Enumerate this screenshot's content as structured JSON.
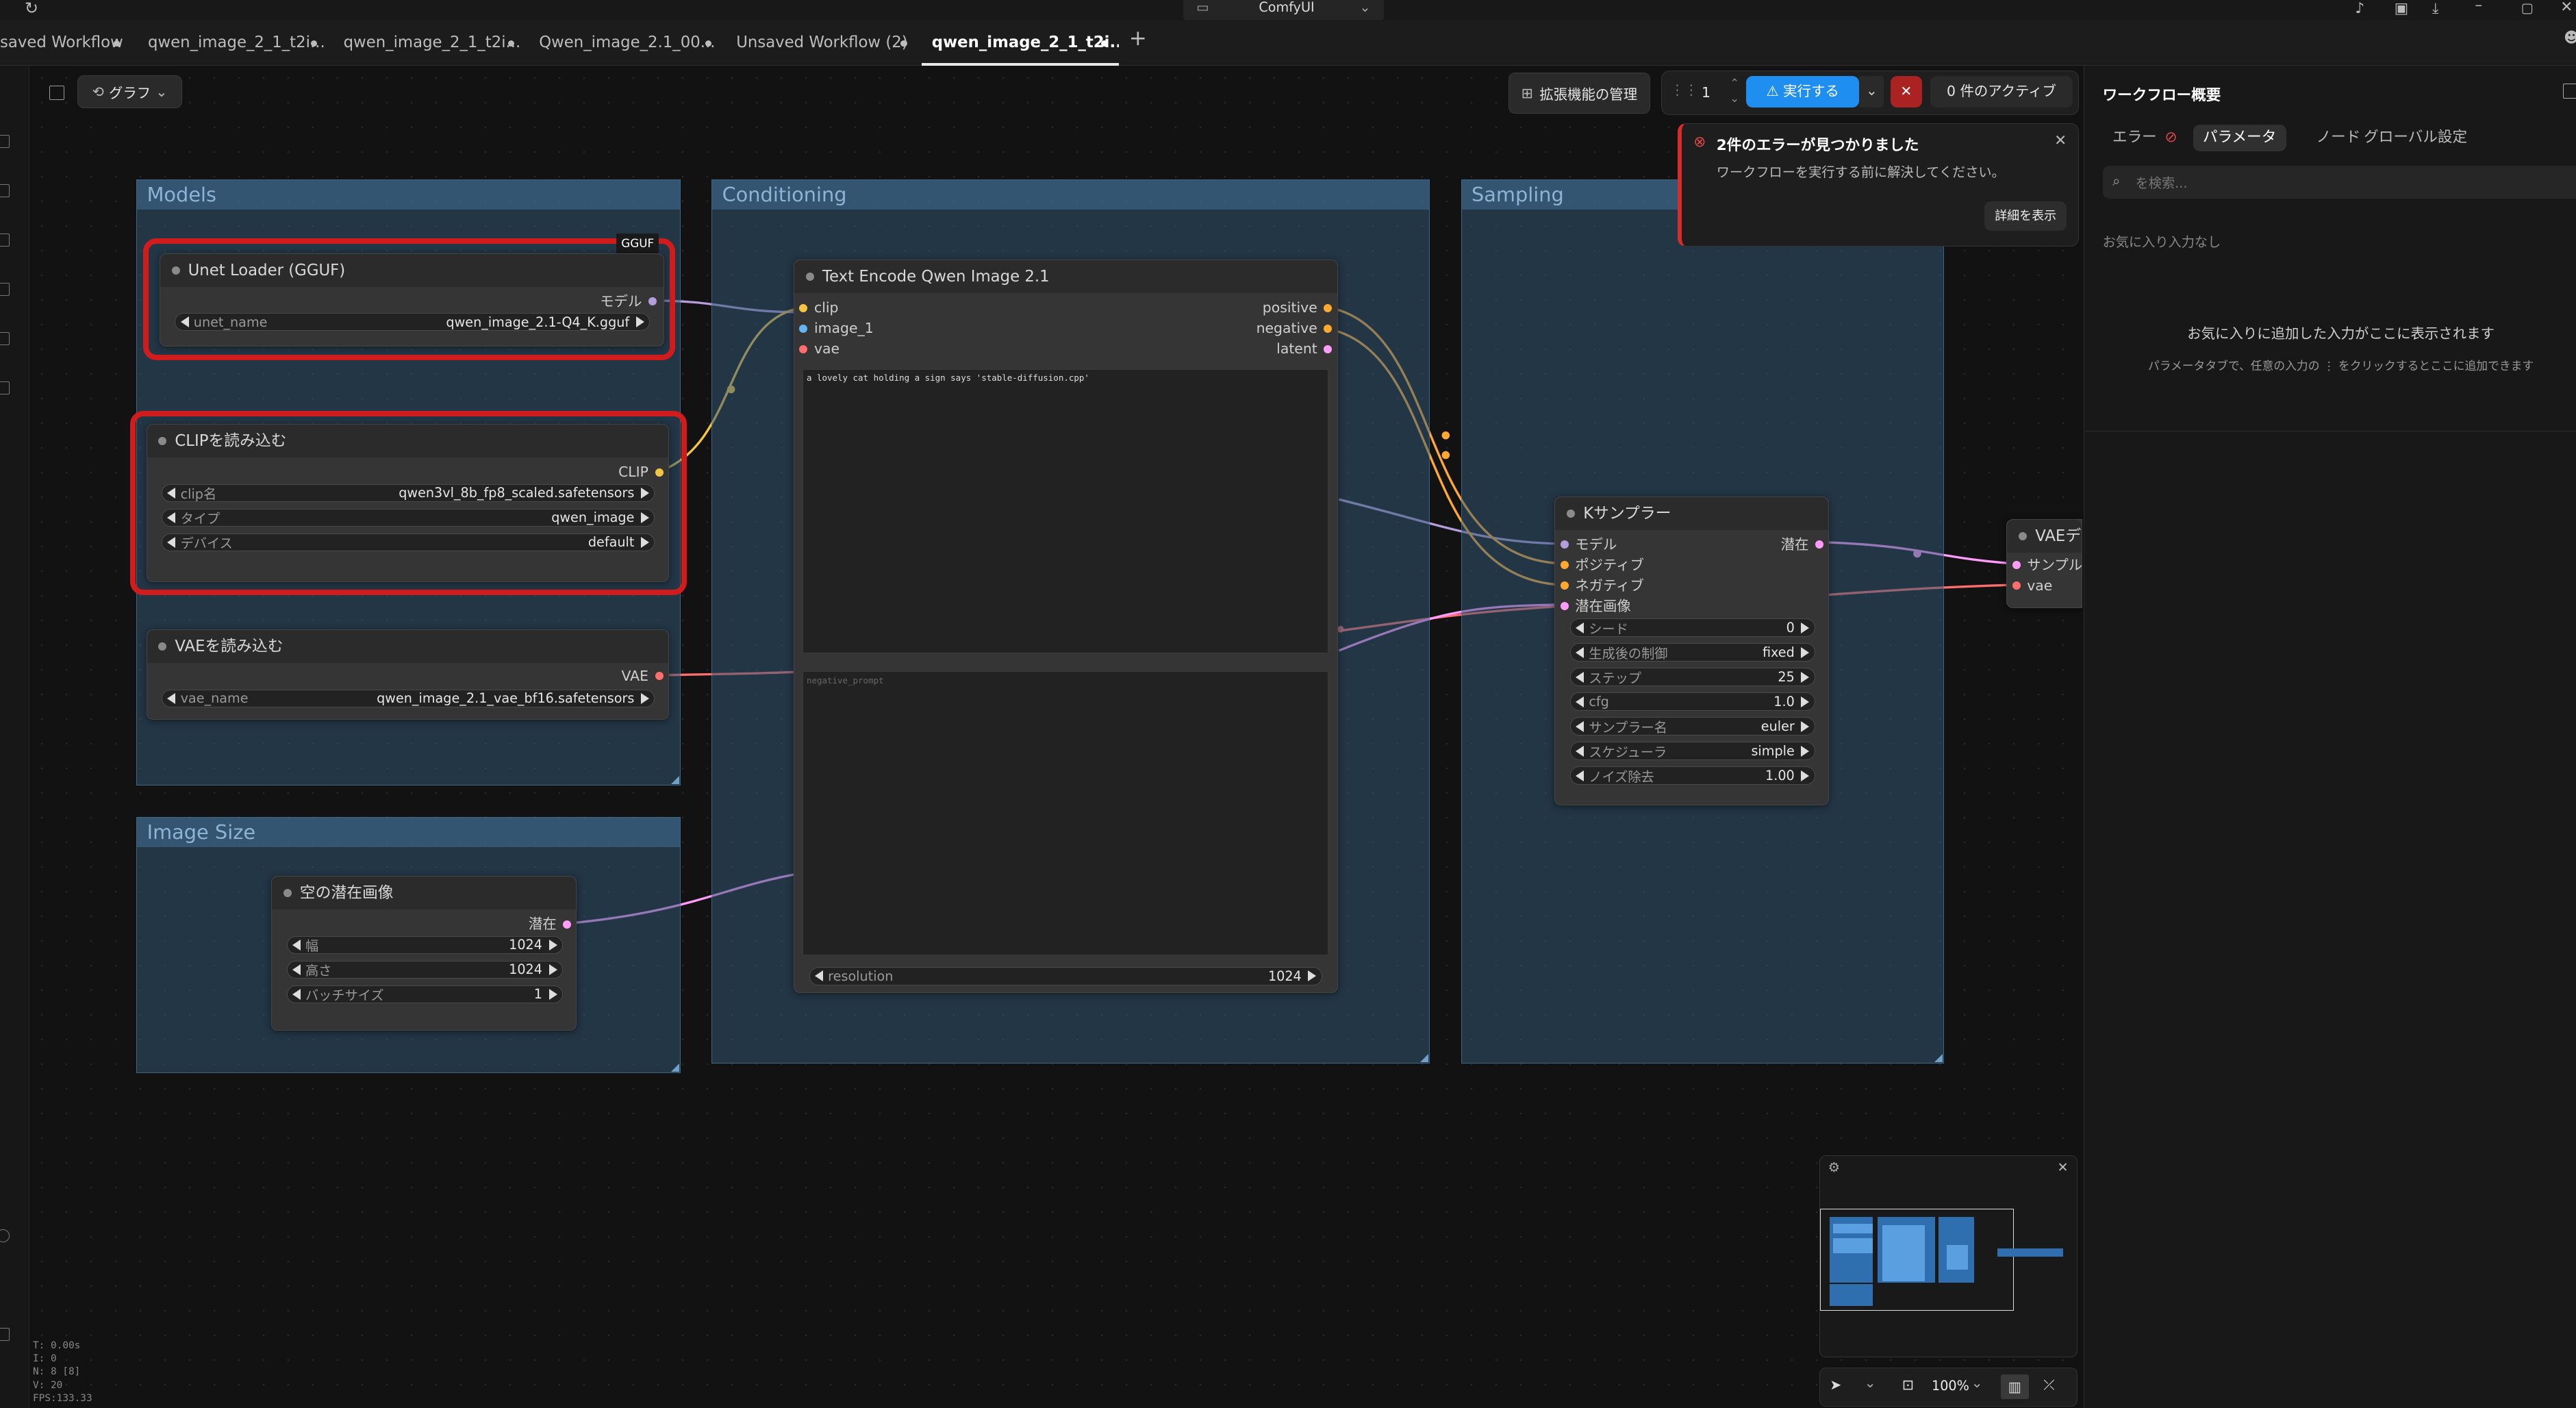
{
  "titlebar": {
    "app_name": "ComfyUI"
  },
  "tabs": [
    {
      "label": "saved Workflow",
      "active": false
    },
    {
      "label": "qwen_image_2_1_t2i...",
      "active": false
    },
    {
      "label": "qwen_image_2_1_t2i...",
      "active": false
    },
    {
      "label": "Qwen_image_2.1_00...",
      "active": false
    },
    {
      "label": "Unsaved Workflow (2)",
      "active": false
    },
    {
      "label": "qwen_image_2_1_t2i...",
      "active": true
    }
  ],
  "canvas_toolbar": {
    "graph_label": "グラフ",
    "extensions_label": "拡張機能の管理",
    "queue_count": "1",
    "run_label": "実行する",
    "active_label": "0 件のアクティブ"
  },
  "error_popup": {
    "title": "2件のエラーが見つかりました",
    "message": "ワークフローを実行する前に解決してください。",
    "details_button": "詳細を表示"
  },
  "right_panel": {
    "title": "ワークフロー概要",
    "tabs": [
      "エラー",
      "パラメータ",
      "ノード",
      "グローバル設定"
    ],
    "active_tab": "パラメータ",
    "search_placeholder": "を検索...",
    "favorites_empty": "お気に入り入力なし",
    "empty_heading": "お気に入りに追加した入力がここに表示されます",
    "empty_hint": "パラメータタブで、任意の入力の ⋮ をクリックするとここに追加できます"
  },
  "groups": {
    "models": "Models",
    "conditioning": "Conditioning",
    "sampling": "Sampling",
    "image_size": "Image Size"
  },
  "nodes": {
    "unet_loader": {
      "badge": "GGUF",
      "title": "Unet Loader (GGUF)",
      "output": "モデル",
      "widgets": [
        {
          "label": "unet_name",
          "value": "qwen_image_2.1-Q4_K.gguf"
        }
      ]
    },
    "clip_loader": {
      "title": "CLIPを読み込む",
      "output": "CLIP",
      "widgets": [
        {
          "label": "clip名",
          "value": "qwen3vl_8b_fp8_scaled.safetensors"
        },
        {
          "label": "タイプ",
          "value": "qwen_image"
        },
        {
          "label": "デバイス",
          "value": "default"
        }
      ]
    },
    "vae_loader": {
      "title": "VAEを読み込む",
      "output": "VAE",
      "widgets": [
        {
          "label": "vae_name",
          "value": "qwen_image_2.1_vae_bf16.safetensors"
        }
      ]
    },
    "text_encode": {
      "title": "Text Encode Qwen Image 2.1",
      "inputs": [
        "clip",
        "image_1",
        "vae"
      ],
      "outputs": [
        "positive",
        "negative",
        "latent"
      ],
      "prompt": "a lovely cat holding a sign says 'stable-diffusion.cpp'",
      "negative_placeholder": "negative_prompt",
      "widgets": [
        {
          "label": "resolution",
          "value": "1024"
        }
      ]
    },
    "ksampler": {
      "title": "Kサンプラー",
      "inputs": [
        "モデル",
        "ポジティブ",
        "ネガティブ",
        "潜在画像"
      ],
      "output": "潜在",
      "widgets": [
        {
          "label": "シード",
          "value": "0"
        },
        {
          "label": "生成後の制御",
          "value": "fixed"
        },
        {
          "label": "ステップ",
          "value": "25"
        },
        {
          "label": "cfg",
          "value": "1.0"
        },
        {
          "label": "サンプラー名",
          "value": "euler"
        },
        {
          "label": "スケジューラ",
          "value": "simple"
        },
        {
          "label": "ノイズ除去",
          "value": "1.00"
        }
      ]
    },
    "vae_decode": {
      "title": "VAEデ",
      "inputs": [
        "サンプル",
        "vae"
      ]
    },
    "empty_latent": {
      "title": "空の潜在画像",
      "output": "潜在",
      "widgets": [
        {
          "label": "幅",
          "value": "1024"
        },
        {
          "label": "高さ",
          "value": "1024"
        },
        {
          "label": "バッチサイズ",
          "value": "1"
        }
      ]
    }
  },
  "bottom_toolbar": {
    "zoom": "100%"
  },
  "stats": [
    "T: 0.00s",
    "I: 0",
    "N: 8 [8]",
    "V: 20",
    "FPS:133.33"
  ],
  "colors": {
    "model_link": "#b39ddb",
    "clip_link": "#f5c542",
    "vae_link": "#ff6e6e",
    "conditioning_link": "#ffa931",
    "latent_link": "#ff9cf9",
    "run_button": "#1f8ef1",
    "error_red": "#d01c1c"
  }
}
